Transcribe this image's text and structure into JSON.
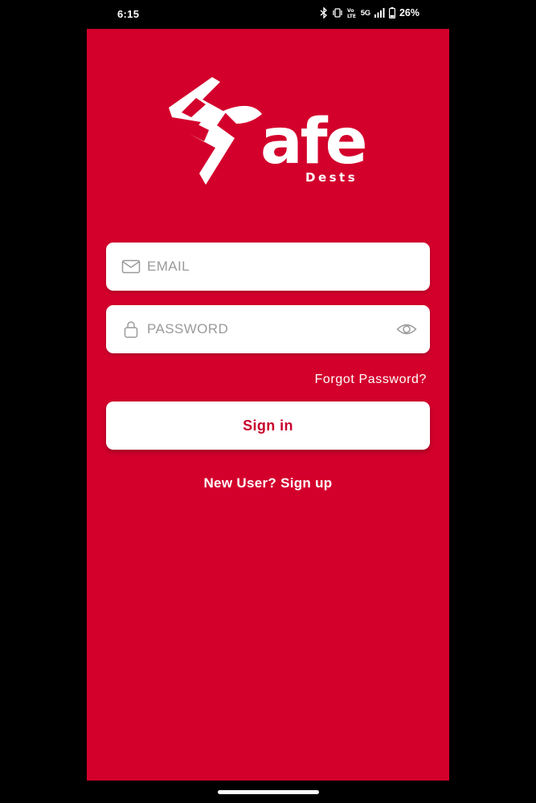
{
  "status_bar": {
    "time": "6:15",
    "network_label": "5G",
    "battery_percent": "26%",
    "icons": [
      "bluetooth-icon",
      "vibrate-icon",
      "volte-icon",
      "signal-icon",
      "battery-icon"
    ],
    "battery_level": 0.26
  },
  "app": {
    "background_color": "#d3002c",
    "logo": {
      "wordmark": "afe",
      "subtitle": "Dests"
    },
    "email_field": {
      "value": "",
      "placeholder": "EMAIL",
      "icon": "mail-icon"
    },
    "password_field": {
      "value": "",
      "placeholder": "PASSWORD",
      "icon": "lock-icon",
      "toggle_icon": "eye-icon"
    },
    "forgot_password_label": "Forgot Password?",
    "sign_in_label": "Sign in",
    "sign_up_label": "New User? Sign up"
  }
}
